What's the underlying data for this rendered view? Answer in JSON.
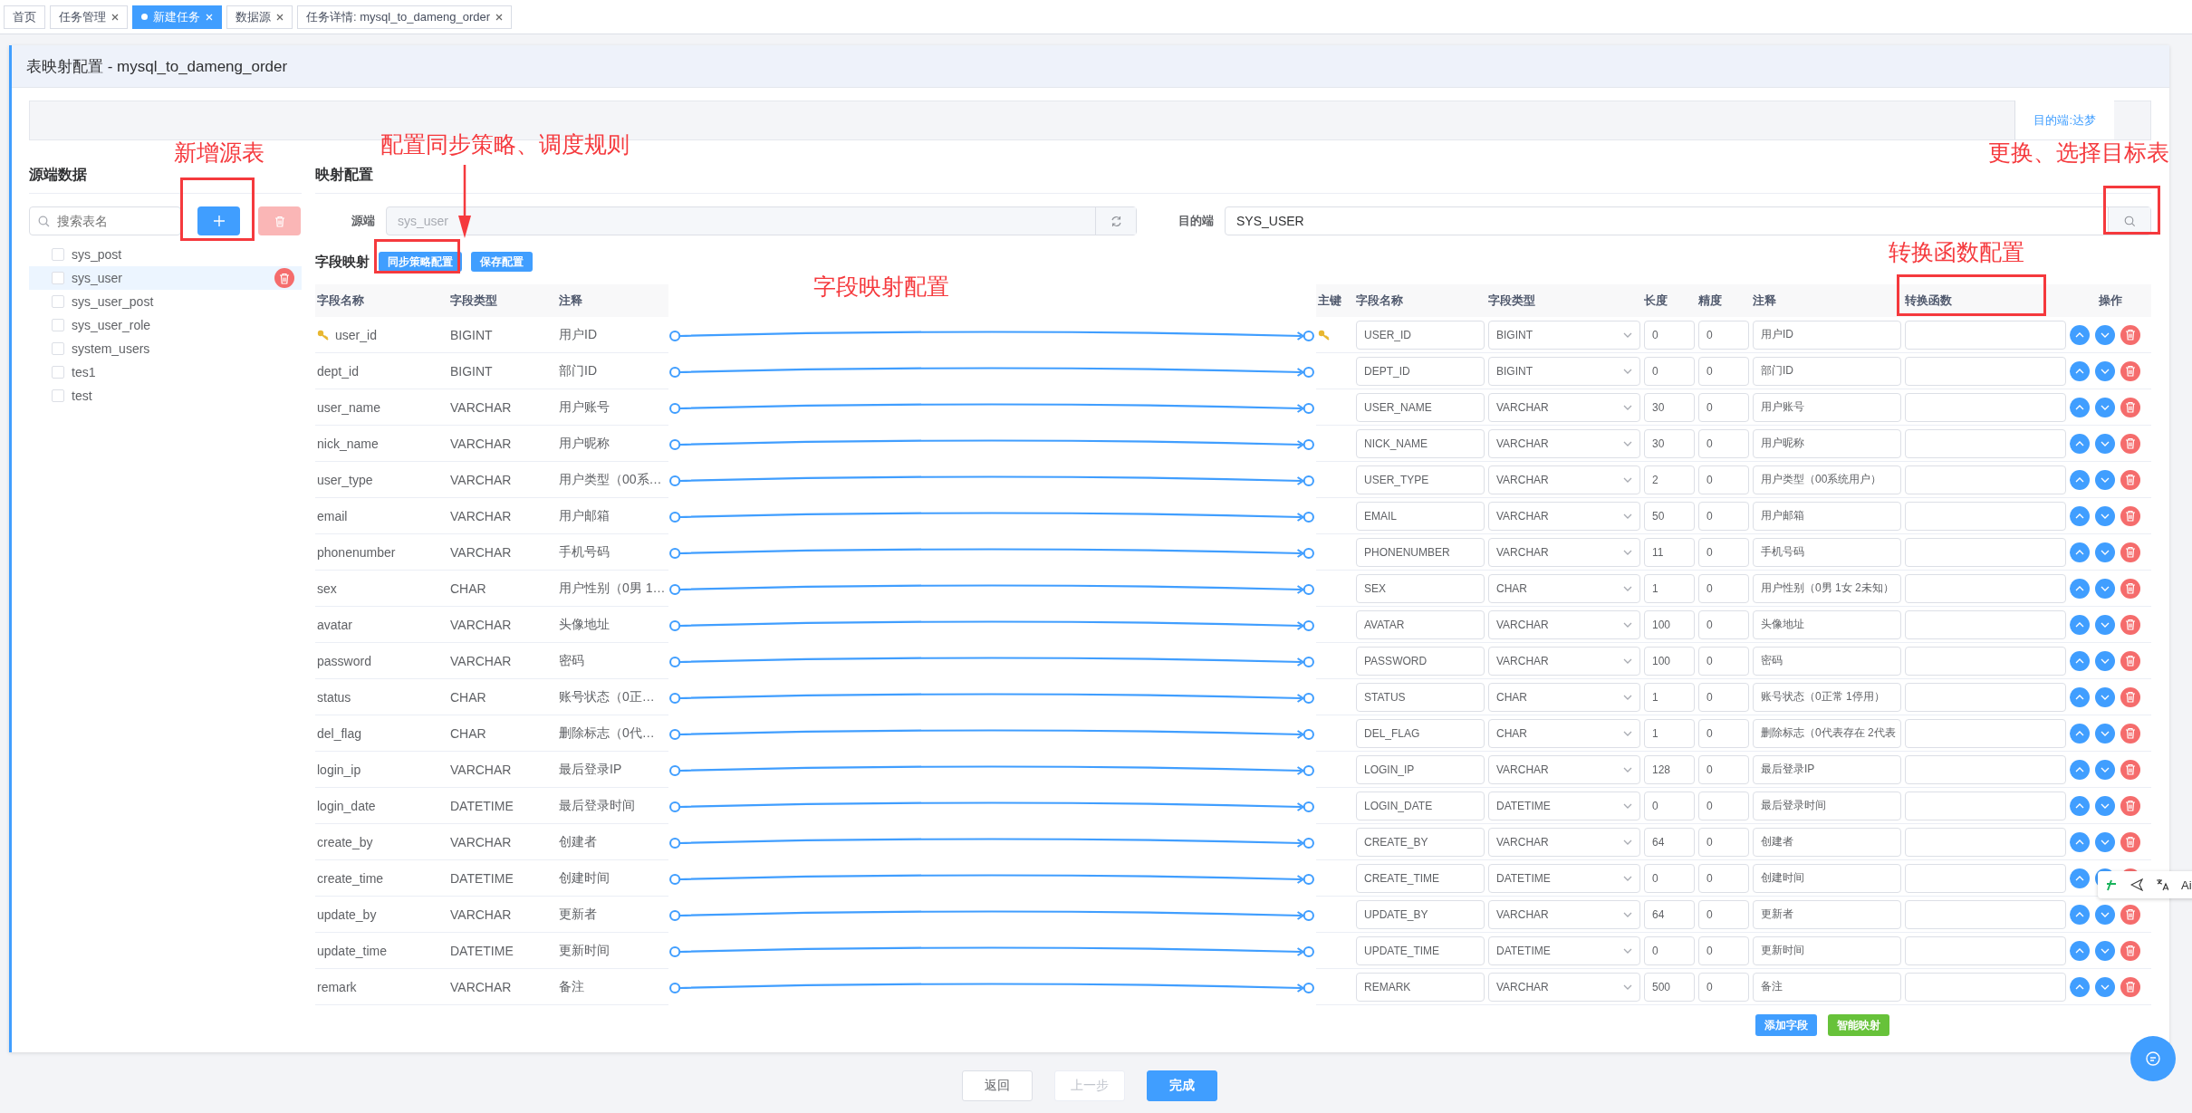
{
  "tabs": [
    {
      "label": "首页",
      "selected": false,
      "closable": false
    },
    {
      "label": "任务管理",
      "selected": false,
      "closable": true
    },
    {
      "label": "新建任务",
      "selected": true,
      "closable": true
    },
    {
      "label": "数据源",
      "selected": false,
      "closable": true
    },
    {
      "label": "任务详情: mysql_to_dameng_order",
      "selected": false,
      "closable": true
    }
  ],
  "page_title": "表映射配置 - mysql_to_dameng_order",
  "target_tab": "目的端:达梦",
  "source_panel": {
    "title": "源端数据",
    "search": {
      "placeholder": "搜索表名"
    },
    "delete_disabled": true,
    "tables": [
      {
        "name": "sys_post",
        "selected": false
      },
      {
        "name": "sys_user",
        "selected": true
      },
      {
        "name": "sys_user_post",
        "selected": false
      },
      {
        "name": "sys_user_role",
        "selected": false
      },
      {
        "name": "system_users",
        "selected": false
      },
      {
        "name": "tes1",
        "selected": false
      },
      {
        "name": "test",
        "selected": false
      }
    ]
  },
  "mapping": {
    "title": "映射配置",
    "source_label": "源端",
    "source_value": "sys_user",
    "target_label": "目的端",
    "target_value": "SYS_USER"
  },
  "fields": {
    "title": "字段映射",
    "buttons": [
      "同步策略配置",
      "保存配置"
    ],
    "source_columns": [
      "字段名称",
      "字段类型",
      "注释"
    ],
    "target_columns": [
      "主键",
      "字段名称",
      "字段类型",
      "长度",
      "精度",
      "注释",
      "转换函数",
      "操作"
    ],
    "rows": [
      {
        "src_name": "user_id",
        "src_type": "BIGINT",
        "src_comment": "用户ID",
        "primary_key": true,
        "name": "USER_ID",
        "type": "BIGINT",
        "length": "0",
        "precision": "0",
        "comment": "用户ID"
      },
      {
        "src_name": "dept_id",
        "src_type": "BIGINT",
        "src_comment": "部门ID",
        "primary_key": false,
        "name": "DEPT_ID",
        "type": "BIGINT",
        "length": "0",
        "precision": "0",
        "comment": "部门ID"
      },
      {
        "src_name": "user_name",
        "src_type": "VARCHAR",
        "src_comment": "用户账号",
        "primary_key": false,
        "name": "USER_NAME",
        "type": "VARCHAR",
        "length": "30",
        "precision": "0",
        "comment": "用户账号"
      },
      {
        "src_name": "nick_name",
        "src_type": "VARCHAR",
        "src_comment": "用户昵称",
        "primary_key": false,
        "name": "NICK_NAME",
        "type": "VARCHAR",
        "length": "30",
        "precision": "0",
        "comment": "用户昵称"
      },
      {
        "src_name": "user_type",
        "src_type": "VARCHAR",
        "src_comment": "用户类型（00系…",
        "primary_key": false,
        "name": "USER_TYPE",
        "type": "VARCHAR",
        "length": "2",
        "precision": "0",
        "comment": "用户类型（00系统用户）"
      },
      {
        "src_name": "email",
        "src_type": "VARCHAR",
        "src_comment": "用户邮箱",
        "primary_key": false,
        "name": "EMAIL",
        "type": "VARCHAR",
        "length": "50",
        "precision": "0",
        "comment": "用户邮箱"
      },
      {
        "src_name": "phonenumber",
        "src_type": "VARCHAR",
        "src_comment": "手机号码",
        "primary_key": false,
        "name": "PHONENUMBER",
        "type": "VARCHAR",
        "length": "11",
        "precision": "0",
        "comment": "手机号码"
      },
      {
        "src_name": "sex",
        "src_type": "CHAR",
        "src_comment": "用户性别（0男 1…",
        "primary_key": false,
        "name": "SEX",
        "type": "CHAR",
        "length": "1",
        "precision": "0",
        "comment": "用户性别（0男 1女 2未知）"
      },
      {
        "src_name": "avatar",
        "src_type": "VARCHAR",
        "src_comment": "头像地址",
        "primary_key": false,
        "name": "AVATAR",
        "type": "VARCHAR",
        "length": "100",
        "precision": "0",
        "comment": "头像地址"
      },
      {
        "src_name": "password",
        "src_type": "VARCHAR",
        "src_comment": "密码",
        "primary_key": false,
        "name": "PASSWORD",
        "type": "VARCHAR",
        "length": "100",
        "precision": "0",
        "comment": "密码"
      },
      {
        "src_name": "status",
        "src_type": "CHAR",
        "src_comment": "账号状态（0正…",
        "primary_key": false,
        "name": "STATUS",
        "type": "CHAR",
        "length": "1",
        "precision": "0",
        "comment": "账号状态（0正常 1停用）"
      },
      {
        "src_name": "del_flag",
        "src_type": "CHAR",
        "src_comment": "删除标志（0代…",
        "primary_key": false,
        "name": "DEL_FLAG",
        "type": "CHAR",
        "length": "1",
        "precision": "0",
        "comment": "删除标志（0代表存在 2代表"
      },
      {
        "src_name": "login_ip",
        "src_type": "VARCHAR",
        "src_comment": "最后登录IP",
        "primary_key": false,
        "name": "LOGIN_IP",
        "type": "VARCHAR",
        "length": "128",
        "precision": "0",
        "comment": "最后登录IP"
      },
      {
        "src_name": "login_date",
        "src_type": "DATETIME",
        "src_comment": "最后登录时间",
        "primary_key": false,
        "name": "LOGIN_DATE",
        "type": "DATETIME",
        "length": "0",
        "precision": "0",
        "comment": "最后登录时间"
      },
      {
        "src_name": "create_by",
        "src_type": "VARCHAR",
        "src_comment": "创建者",
        "primary_key": false,
        "name": "CREATE_BY",
        "type": "VARCHAR",
        "length": "64",
        "precision": "0",
        "comment": "创建者"
      },
      {
        "src_name": "create_time",
        "src_type": "DATETIME",
        "src_comment": "创建时间",
        "primary_key": false,
        "name": "CREATE_TIME",
        "type": "DATETIME",
        "length": "0",
        "precision": "0",
        "comment": "创建时间"
      },
      {
        "src_name": "update_by",
        "src_type": "VARCHAR",
        "src_comment": "更新者",
        "primary_key": false,
        "name": "UPDATE_BY",
        "type": "VARCHAR",
        "length": "64",
        "precision": "0",
        "comment": "更新者"
      },
      {
        "src_name": "update_time",
        "src_type": "DATETIME",
        "src_comment": "更新时间",
        "primary_key": false,
        "name": "UPDATE_TIME",
        "type": "DATETIME",
        "length": "0",
        "precision": "0",
        "comment": "更新时间"
      },
      {
        "src_name": "remark",
        "src_type": "VARCHAR",
        "src_comment": "备注",
        "primary_key": false,
        "name": "REMARK",
        "type": "VARCHAR",
        "length": "500",
        "precision": "0",
        "comment": "备注"
      }
    ],
    "footer_buttons": [
      "添加字段",
      "智能映射"
    ]
  },
  "footer": [
    {
      "label": "返回",
      "kind": "default"
    },
    {
      "label": "上一步",
      "kind": "disabled"
    },
    {
      "label": "完成",
      "kind": "primary"
    }
  ],
  "floating_toolbar": {
    "label": "Ai"
  },
  "annotations": [
    "新增源表",
    "配置同步策略、调度规则",
    "字段映射配置",
    "更换、选择目标表",
    "转换函数配置"
  ]
}
